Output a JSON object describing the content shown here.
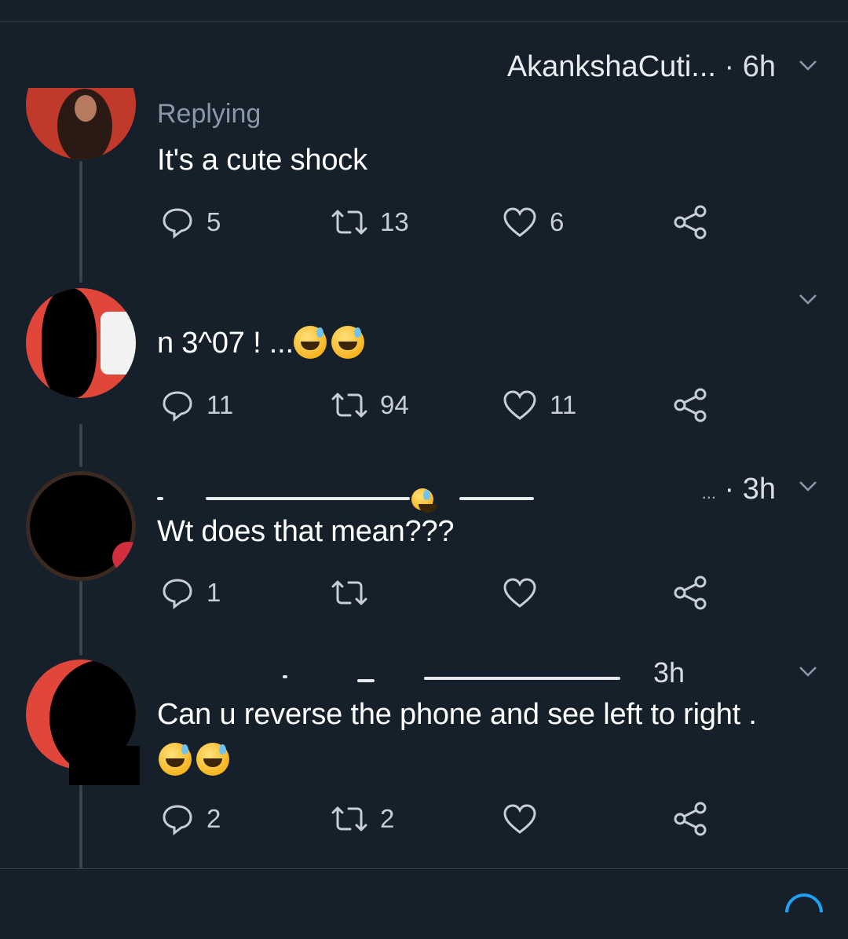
{
  "tweets": [
    {
      "header": {
        "name": "AkankshaCuti...",
        "time": "· 6h"
      },
      "replying": "Replying",
      "text": "It's a cute shock",
      "emojis": 0,
      "actions": {
        "reply": "5",
        "retweet": "13",
        "like": "6"
      }
    },
    {
      "header": {
        "name": "",
        "time": ""
      },
      "text": "n 3^07 ! ...",
      "emojis": 2,
      "actions": {
        "reply": "11",
        "retweet": "94",
        "like": "11"
      }
    },
    {
      "header": {
        "name": "...",
        "time": "· 3h"
      },
      "text": "Wt does that mean???",
      "emojis": 0,
      "actions": {
        "reply": "1",
        "retweet": "",
        "like": ""
      }
    },
    {
      "header": {
        "name": "",
        "time": "3h"
      },
      "text": "Can u reverse the phone and see left to right .",
      "emojis": 2,
      "actions": {
        "reply": "2",
        "retweet": "2",
        "like": ""
      }
    }
  ],
  "icons": {
    "reply": "reply-icon",
    "retweet": "retweet-icon",
    "like": "heart-icon",
    "share": "share-icon",
    "menu": "chevron-down-icon"
  },
  "colors": {
    "background": "#15202b",
    "text": "#ffffff",
    "secondary": "#8899a6",
    "accent": "#1da1f2"
  }
}
